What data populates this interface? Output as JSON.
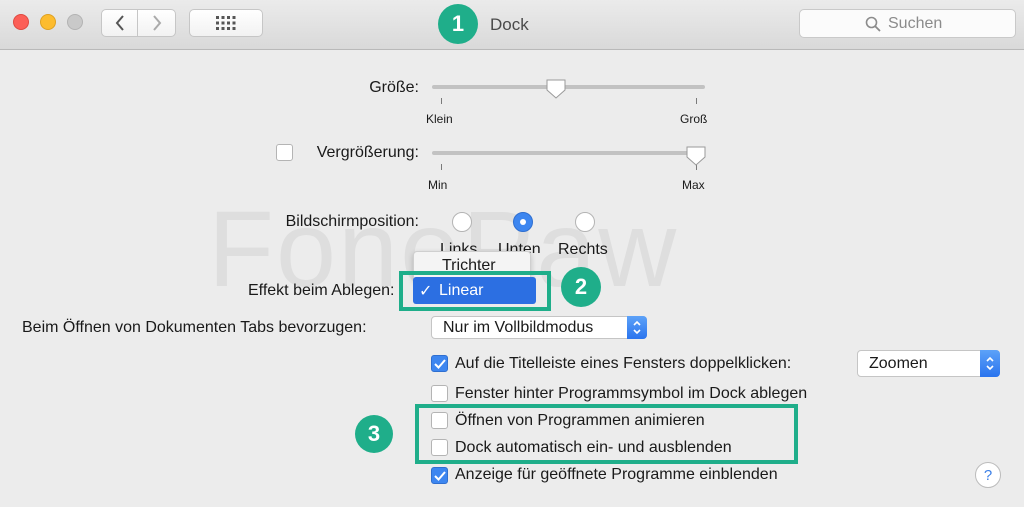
{
  "window": {
    "title": "Dock"
  },
  "search": {
    "placeholder": "Suchen"
  },
  "watermark": "FonePaw",
  "badges": {
    "one": "1",
    "two": "2",
    "three": "3"
  },
  "size": {
    "label": "Größe:",
    "min_label": "Klein",
    "max_label": "Groß",
    "level": 0.45
  },
  "magnification": {
    "label": "Vergrößerung:",
    "checked": false,
    "min_label": "Min",
    "max_label": "Max",
    "level": 1.0
  },
  "position": {
    "label": "Bildschirmposition:",
    "options": [
      {
        "label": "Links",
        "selected": false
      },
      {
        "label": "Unten",
        "selected": true
      },
      {
        "label": "Rechts",
        "selected": false
      }
    ]
  },
  "minimize_effect": {
    "label": "Effekt beim Ablegen:",
    "menu_items": [
      {
        "label": "Trichter",
        "selected": false
      },
      {
        "label": "Linear",
        "selected": true
      }
    ],
    "check_mark": "✓"
  },
  "tabs_pref": {
    "label": "Beim Öffnen von Dokumenten Tabs bevorzugen:",
    "value": "Nur im Vollbildmodus"
  },
  "checkboxes": {
    "titlebar": {
      "label": "Auf die Titelleiste eines Fensters doppelklicken:",
      "checked": true,
      "action": "Zoomen"
    },
    "minimize_into_icon": {
      "label": "Fenster hinter Programmsymbol im Dock ablegen",
      "checked": false
    },
    "animate": {
      "label": "Öffnen von Programmen animieren",
      "checked": false
    },
    "autohide": {
      "label": "Dock automatisch ein- und ausblenden",
      "checked": false
    },
    "indicators": {
      "label": "Anzeige für geöffnete Programme einblenden",
      "checked": true
    }
  },
  "help": {
    "label": "?"
  },
  "colors": {
    "accent": "#1fae8a",
    "selection": "#2c6fe2",
    "checkbox_on": "#3d86f0"
  }
}
